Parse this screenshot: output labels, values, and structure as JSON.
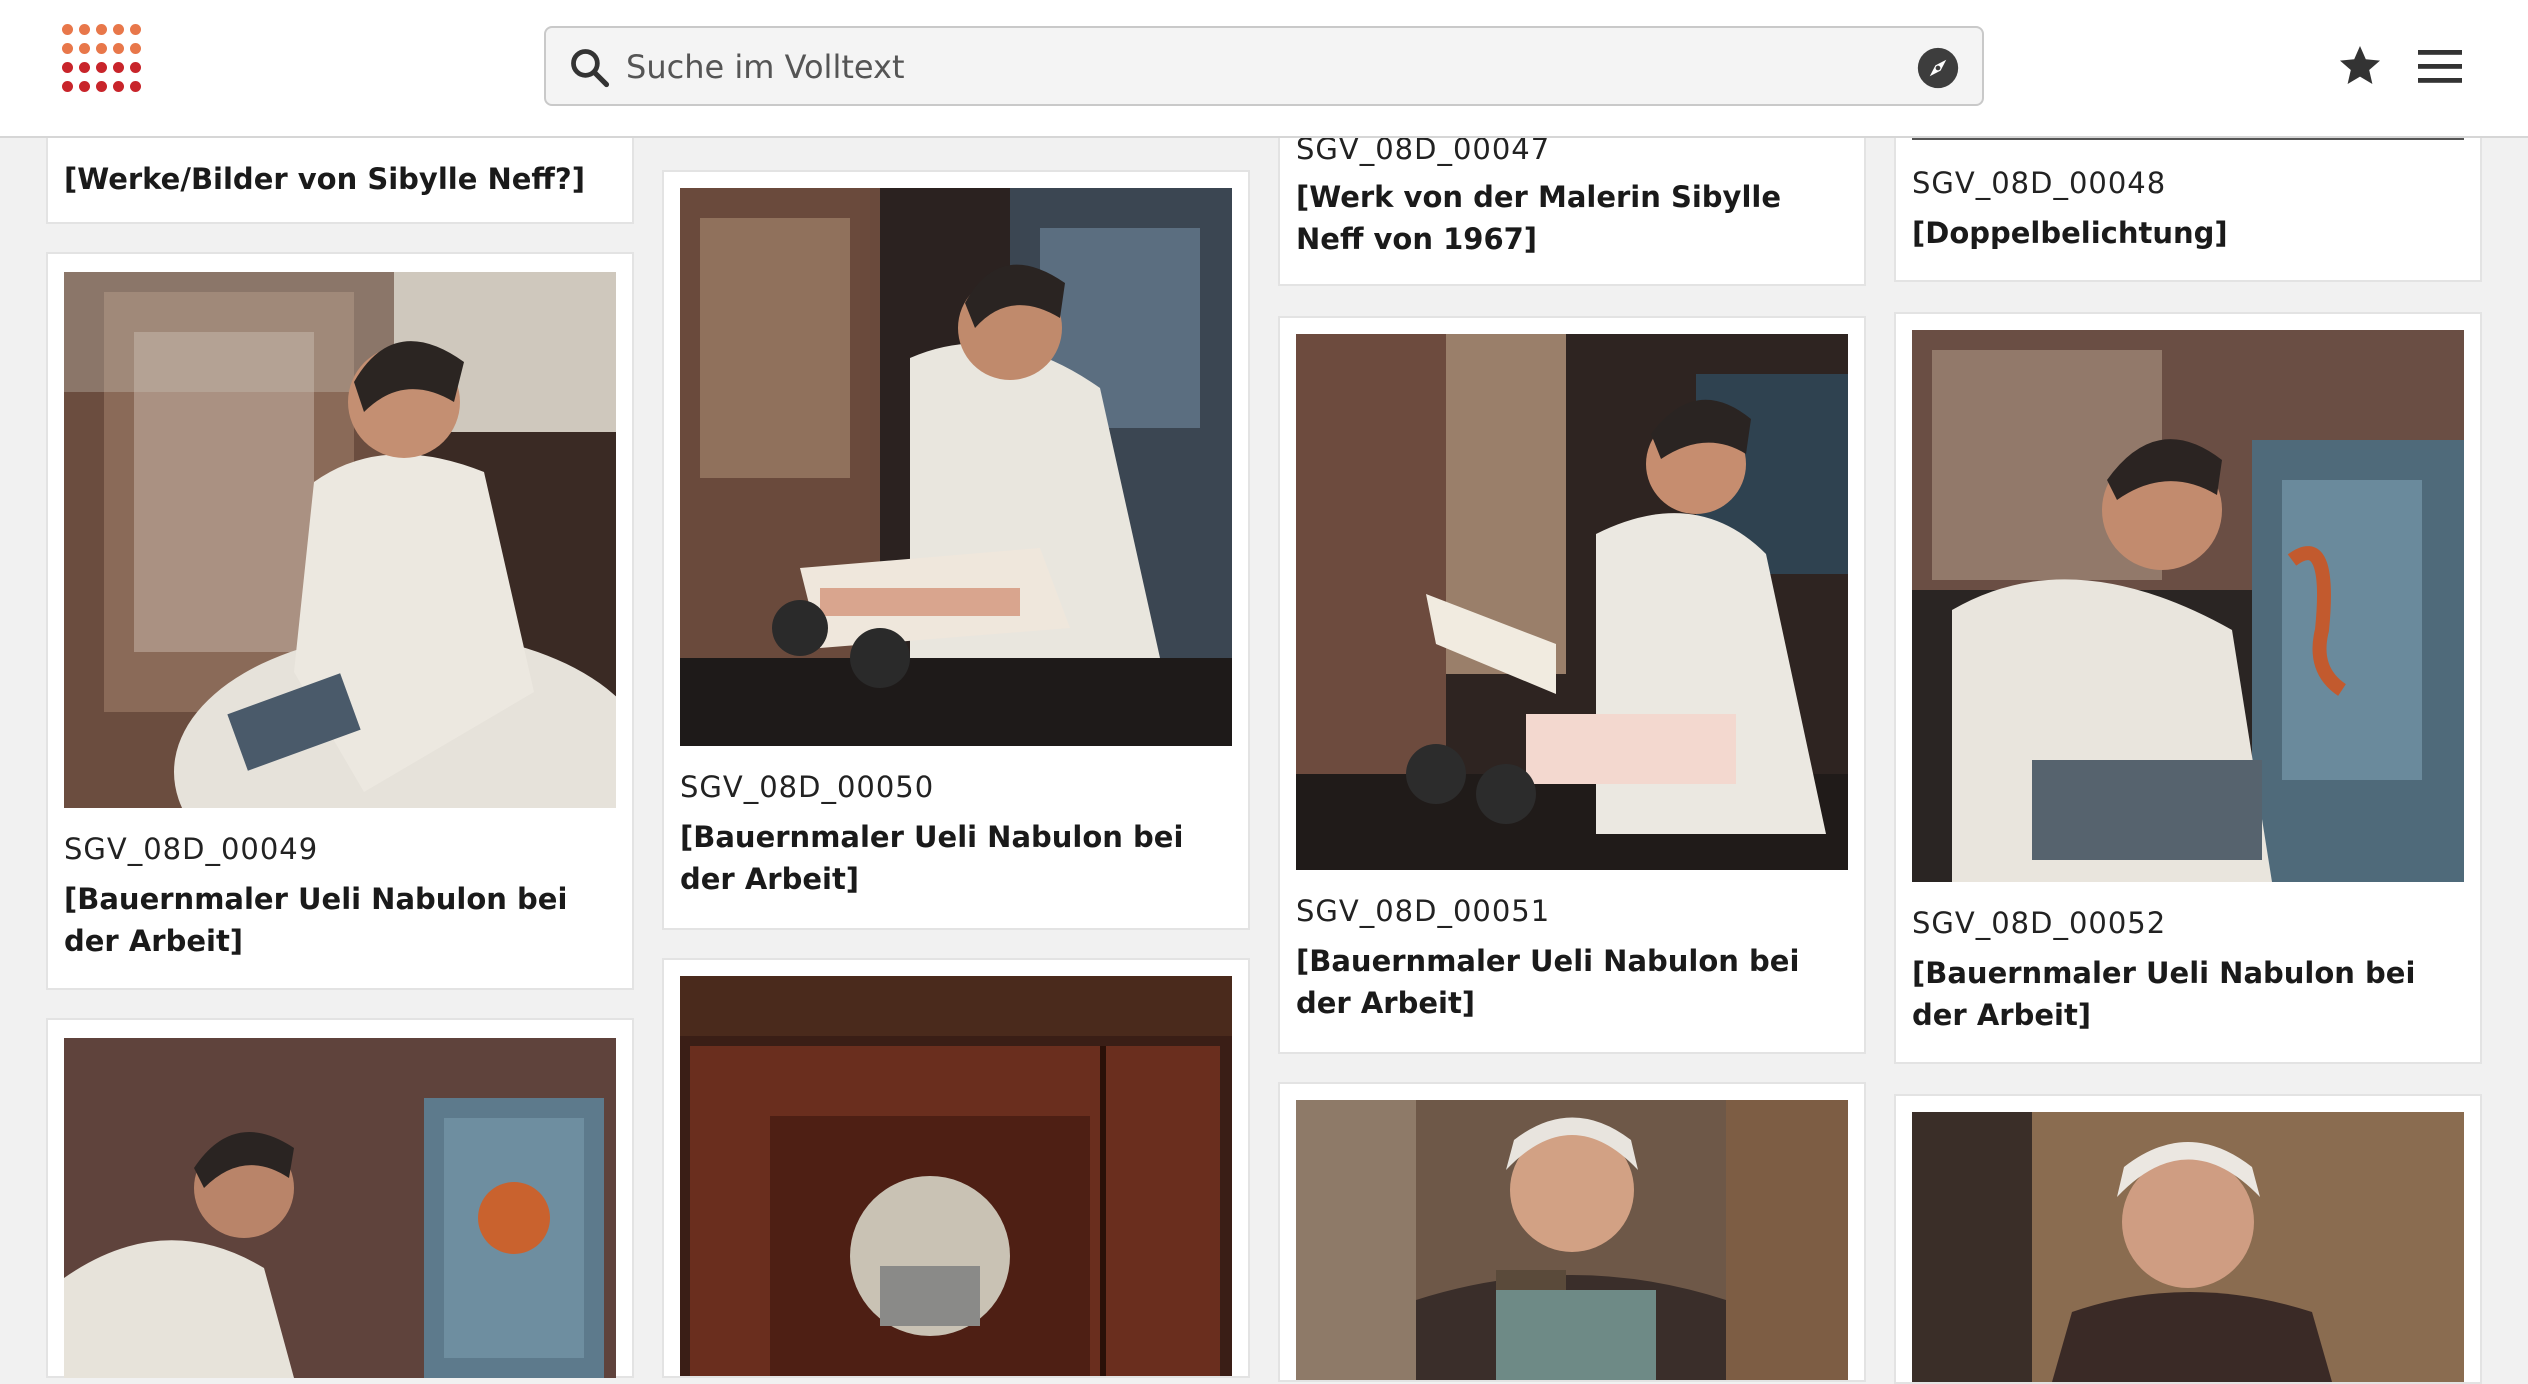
{
  "header": {
    "logo_name": "dot-grid-logo",
    "search_placeholder": "Suche im Volltext",
    "search_icon": "search-icon",
    "explore_icon": "compass-icon",
    "favorites_icon": "star-icon",
    "menu_icon": "hamburger-menu-icon"
  },
  "colors": {
    "logo_dots_top": "#e8774a",
    "logo_dots_bottom": "#c8242a",
    "header_bg": "#ffffff",
    "page_bg": "#f1f1f1"
  },
  "cards": [
    {
      "col": 0,
      "id": "",
      "title": "[Werke/Bilder von Sibylle Neff?]",
      "photo": "painting-photo"
    },
    {
      "col": 0,
      "id": "SGV_08D_00049",
      "title": "[Bauernmaler Ueli Nabulon bei der Arbeit]",
      "photo": "painter-at-cabinet-photo"
    },
    {
      "col": 0,
      "id": "",
      "title": "",
      "photo": "painter-blue-cabinet-photo"
    },
    {
      "col": 1,
      "id": "SGV_08D_00050",
      "title": "[Bauernmaler Ueli Nabulon bei der Arbeit]",
      "photo": "painter-seated-photo"
    },
    {
      "col": 1,
      "id": "",
      "title": "",
      "photo": "painted-chest-photo"
    },
    {
      "col": 2,
      "id": "SGV_08D_00047",
      "title": "[Werk von der Malerin Sibylle Neff von 1967]",
      "photo": ""
    },
    {
      "col": 2,
      "id": "SGV_08D_00051",
      "title": "[Bauernmaler Ueli Nabulon bei der Arbeit]",
      "photo": "painter-side-photo"
    },
    {
      "col": 2,
      "id": "",
      "title": "",
      "photo": "old-man-hammer-photo"
    },
    {
      "col": 3,
      "id": "SGV_08D_00048",
      "title": "[Doppelbelichtung]",
      "photo": ""
    },
    {
      "col": 3,
      "id": "SGV_08D_00052",
      "title": "[Bauernmaler Ueli Nabulon bei der Arbeit]",
      "photo": "painter-pipe-photo"
    },
    {
      "col": 3,
      "id": "",
      "title": "",
      "photo": "old-man-workshop-photo"
    }
  ]
}
